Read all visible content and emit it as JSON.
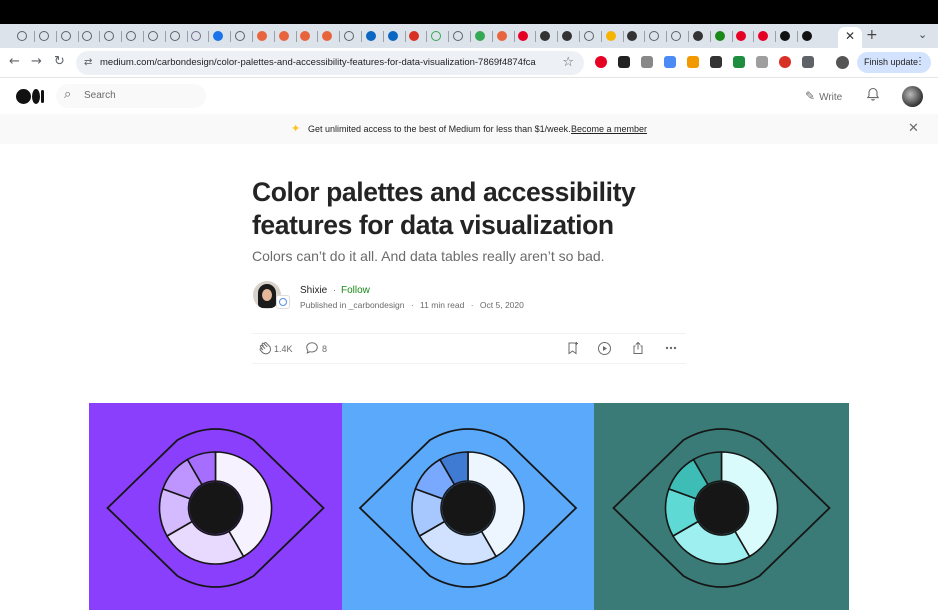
{
  "browser": {
    "tab_favicons": [
      {
        "name": "tab-favicon-1",
        "color": "#5f6368",
        "style": "ring"
      },
      {
        "name": "tab-favicon-2",
        "color": "#5f6368",
        "style": "ring"
      },
      {
        "name": "tab-favicon-3",
        "color": "#5f6368",
        "style": "ring"
      },
      {
        "name": "tab-favicon-4",
        "color": "#5f6368",
        "style": "ring"
      },
      {
        "name": "tab-favicon-5",
        "color": "#5f6368",
        "style": "ring"
      },
      {
        "name": "tab-favicon-6",
        "color": "#5f6368",
        "style": "ring"
      },
      {
        "name": "tab-favicon-7",
        "color": "#5f6368",
        "style": "ring"
      },
      {
        "name": "tab-favicon-8",
        "color": "#5f6368",
        "style": "ring"
      },
      {
        "name": "tab-favicon-9",
        "color": "#7a6b8f",
        "style": "ring"
      },
      {
        "name": "tab-favicon-10",
        "color": "#1a73e8",
        "style": "solid"
      },
      {
        "name": "tab-favicon-11",
        "color": "#5f6368",
        "style": "ring"
      },
      {
        "name": "tab-favicon-12",
        "color": "#e8643c",
        "style": "solid"
      },
      {
        "name": "tab-favicon-13",
        "color": "#e8643c",
        "style": "solid"
      },
      {
        "name": "tab-favicon-14",
        "color": "#e8643c",
        "style": "solid"
      },
      {
        "name": "tab-favicon-15",
        "color": "#e8643c",
        "style": "solid"
      },
      {
        "name": "tab-favicon-16",
        "color": "#5f6368",
        "style": "ring"
      },
      {
        "name": "tab-favicon-17",
        "color": "#0a66c2",
        "style": "solid"
      },
      {
        "name": "tab-favicon-18",
        "color": "#0a66c2",
        "style": "solid"
      },
      {
        "name": "tab-favicon-19",
        "color": "#d93025",
        "style": "solid"
      },
      {
        "name": "tab-favicon-20",
        "color": "#34a853",
        "style": "ring"
      },
      {
        "name": "tab-favicon-21",
        "color": "#5f6368",
        "style": "ring"
      },
      {
        "name": "tab-favicon-22",
        "color": "#34a853",
        "style": "solid"
      },
      {
        "name": "tab-favicon-23",
        "color": "#e8643c",
        "style": "solid"
      },
      {
        "name": "tab-favicon-24",
        "color": "#e60023",
        "style": "solid"
      },
      {
        "name": "tab-favicon-25",
        "color": "#333333",
        "style": "solid"
      },
      {
        "name": "tab-favicon-26",
        "color": "#333333",
        "style": "solid"
      },
      {
        "name": "tab-favicon-27",
        "color": "#5f6368",
        "style": "ring"
      },
      {
        "name": "tab-favicon-28",
        "color": "#f4b400",
        "style": "solid"
      },
      {
        "name": "tab-favicon-29",
        "color": "#333333",
        "style": "solid"
      },
      {
        "name": "tab-favicon-30",
        "color": "#5f6368",
        "style": "ring"
      },
      {
        "name": "tab-favicon-31",
        "color": "#5f6368",
        "style": "ring"
      },
      {
        "name": "tab-favicon-32",
        "color": "#333333",
        "style": "solid"
      },
      {
        "name": "tab-favicon-33",
        "color": "#1a8917",
        "style": "solid"
      },
      {
        "name": "tab-favicon-34",
        "color": "#e60023",
        "style": "solid"
      },
      {
        "name": "tab-favicon-35",
        "color": "#e60023",
        "style": "solid"
      },
      {
        "name": "tab-favicon-36",
        "color": "#111111",
        "style": "solid"
      },
      {
        "name": "tab-favicon-37",
        "color": "#111111",
        "style": "solid"
      }
    ],
    "active_tab_close": "✕",
    "new_tab": "+",
    "tab_menu": "⌄",
    "nav": {
      "back": "←",
      "forward": "→",
      "reload": "↻"
    },
    "omnibox": {
      "site_icon": "⇄",
      "url": "medium.com/carbondesign/color-palettes-and-accessibility-features-for-data-visualization-7869f4874fca",
      "star": "☆"
    },
    "extensions": [
      {
        "name": "pinterest-ext",
        "color": "#e60023"
      },
      {
        "name": "dark-ext",
        "color": "#222222"
      },
      {
        "name": "text-ext",
        "color": "#888888"
      },
      {
        "name": "blue-ext",
        "color": "#4c8bf5"
      },
      {
        "name": "orange-ext",
        "color": "#f29900"
      },
      {
        "name": "feather-ext",
        "color": "#333333"
      },
      {
        "name": "green-ext",
        "color": "#1e8e3e"
      },
      {
        "name": "gray-ext",
        "color": "#9e9e9e"
      },
      {
        "name": "red-ext",
        "color": "#d93025"
      },
      {
        "name": "puzzle-ext",
        "color": "#5f6368"
      }
    ],
    "update_button": "Finish update",
    "update_menu": "⋮"
  },
  "medium": {
    "search_placeholder": "Search",
    "search_icon": "⌕",
    "write_label": "Write",
    "write_icon": "✎",
    "bell_icon": "🔔",
    "colors": {
      "green": "#1a8917",
      "text": "#242424",
      "muted": "#6b6b6b",
      "spark": "#ffc017"
    }
  },
  "banner": {
    "spark": "✦",
    "text": "Get unlimited access to the best of Medium for less than $1/week.",
    "link": "Become a member",
    "close": "✕"
  },
  "article": {
    "title": "Color palettes and accessibility features for data visualization",
    "subtitle": "Colors can’t do it all. And data tables really aren’t so bad.",
    "author": "Shixie",
    "follow": "Follow",
    "separator": "·",
    "published_prefix": "Published in",
    "publication": "_carbondesign",
    "read_time": "11 min read",
    "date": "Oct 5, 2020",
    "claps": "1.4K",
    "responses": "8",
    "icons": {
      "clap": "👏",
      "comment": "💬",
      "bookmark": "⊞",
      "play": "▷",
      "share": "⇪",
      "more": "···"
    }
  },
  "hero": {
    "panels": [
      {
        "bg": "#8a3ffc",
        "iris": [
          "#f6f2ff",
          "#e8daff",
          "#d4bbff",
          "#be95ff",
          "#a56eff"
        ]
      },
      {
        "bg": "#5aa9fa",
        "iris": [
          "#edf5ff",
          "#d0e2ff",
          "#a6c8ff",
          "#78a9ff",
          "#3f7ad3"
        ]
      },
      {
        "bg": "#3a7b77",
        "iris": [
          "#d9fbfb",
          "#9ef0f0",
          "#5fd9d3",
          "#3ebcb6",
          "#37807c"
        ]
      }
    ]
  }
}
